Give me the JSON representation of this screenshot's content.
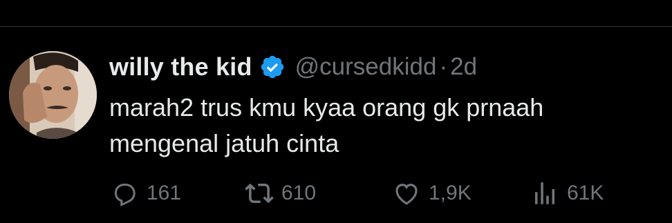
{
  "post": {
    "author": {
      "display_name": "willy the kid",
      "handle": "@cursedkidd",
      "verified": true
    },
    "separator": "·",
    "time": "2d",
    "text_lines": [
      "marah2 trus kmu kyaa orang gk prnaah",
      "mengenal jatuh cinta"
    ]
  },
  "actions": {
    "reply": {
      "icon": "reply-icon",
      "count": "161"
    },
    "retweet": {
      "icon": "retweet-icon",
      "count": "610"
    },
    "like": {
      "icon": "heart-icon",
      "count": "1,9K"
    },
    "views": {
      "icon": "views-icon",
      "count": "61K"
    }
  },
  "colors": {
    "background": "#000000",
    "primary_text": "#e7e9ea",
    "secondary_text": "#71767b",
    "verified_badge": "#1d9bf0",
    "divider": "#2f3336"
  }
}
